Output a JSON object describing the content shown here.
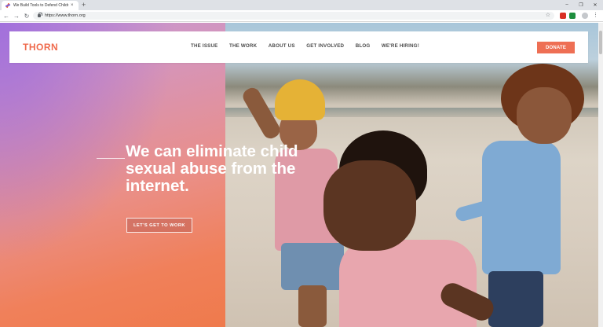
{
  "browser": {
    "tab_title": "We Build Tools to Defend Childr...",
    "tab_close": "×",
    "new_tab": "+",
    "url": "https://www.thorn.org",
    "window_controls": [
      "–",
      "❐",
      "✕"
    ],
    "nav_icons": [
      "back-icon",
      "forward-icon",
      "reload-icon"
    ],
    "star": "☆",
    "menu": "⋮"
  },
  "header": {
    "logo": "THORN",
    "nav": [
      "THE ISSUE",
      "THE WORK",
      "ABOUT US",
      "GET INVOLVED",
      "BLOG",
      "WE'RE HIRING!"
    ],
    "donate_label": "DONATE"
  },
  "hero": {
    "headline_lines": [
      "We can eliminate child",
      "sexual abuse from the",
      "internet."
    ],
    "cta_label": "LET'S GET TO WORK"
  },
  "colors": {
    "brand_accent": "#ee6f54",
    "nav_text": "#4b4b4b"
  }
}
